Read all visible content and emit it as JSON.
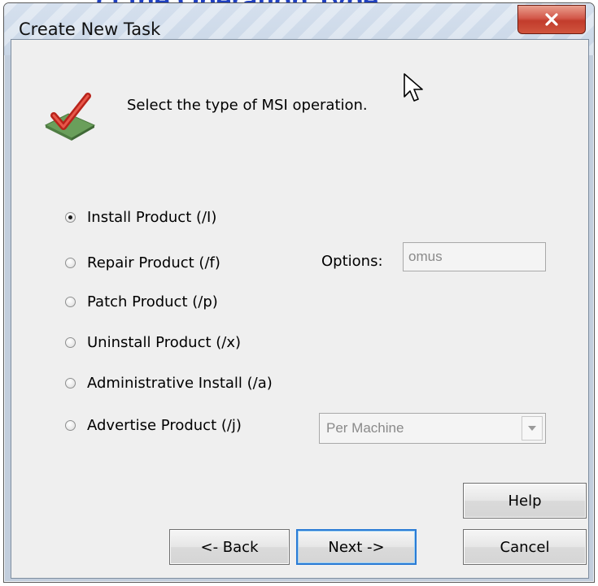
{
  "background": {
    "heading_fragment": "ct the Operation Type"
  },
  "window": {
    "title": "Create New Task",
    "close_label": "X",
    "accent": "#c7d3e2",
    "close_color": "#c23c2c"
  },
  "header": {
    "prompt": "Select the type of MSI operation."
  },
  "operations": {
    "items": [
      {
        "label": "Install Product (/I)",
        "checked": true
      },
      {
        "label": "Repair Product  (/f)",
        "checked": false
      },
      {
        "label": "Patch Product (/p)",
        "checked": false
      },
      {
        "label": "Uninstall Product  (/x)",
        "checked": false
      },
      {
        "label": "Administrative Install (/a)",
        "checked": false
      },
      {
        "label": "Advertise Product  (/j)",
        "checked": false
      }
    ]
  },
  "repair_options": {
    "label": "Options:",
    "value": "omus"
  },
  "advertise_scope": {
    "selected": "Per Machine"
  },
  "buttons": {
    "help": "Help",
    "back": "<- Back",
    "next": "Next ->",
    "cancel": "Cancel"
  },
  "icons": {
    "task": "check-mark-icon",
    "cursor": "mouse-pointer-icon",
    "close": "close-icon",
    "dropdown": "chevron-down-icon"
  }
}
